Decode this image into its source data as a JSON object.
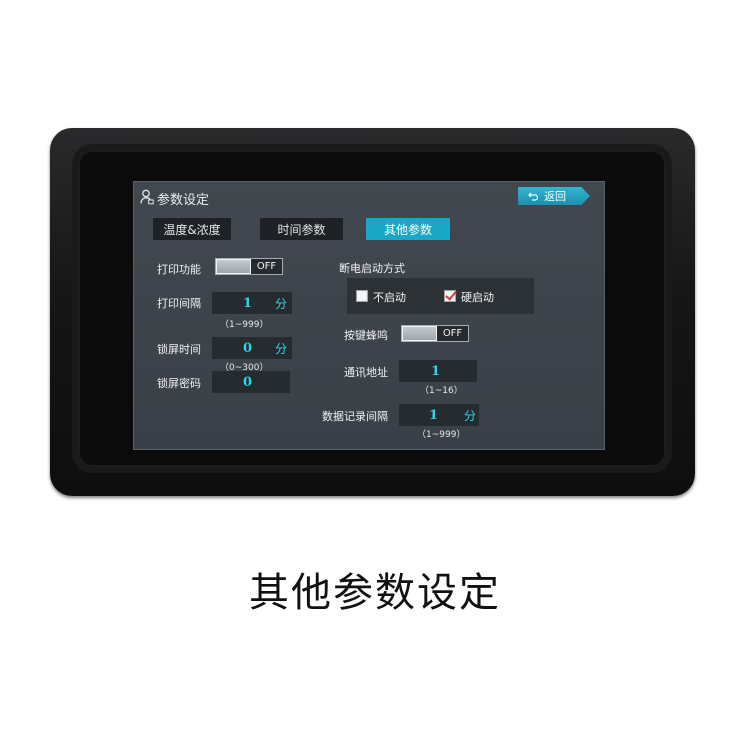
{
  "header": {
    "title": "参数设定",
    "back_label": "返回",
    "back_icon": "return-arrow-icon"
  },
  "tabs": [
    {
      "label": "温度&浓度",
      "active": false
    },
    {
      "label": "时间参数",
      "active": false
    },
    {
      "label": "其他参数",
      "active": true
    }
  ],
  "print_function": {
    "label": "打印功能",
    "state": "OFF"
  },
  "print_interval": {
    "label": "打印间隔",
    "value": "1",
    "unit": "分",
    "range": "（1~999）"
  },
  "lock_time": {
    "label": "锁屏时间",
    "value": "0",
    "unit": "分",
    "range": "（0~300）"
  },
  "lock_password": {
    "label": "锁屏密码",
    "value": "0"
  },
  "power_off_start": {
    "label": "断电启动方式",
    "options": [
      {
        "label": "不启动",
        "checked": false
      },
      {
        "label": "硬启动",
        "checked": true
      }
    ]
  },
  "key_beep": {
    "label": "按键蜂鸣",
    "state": "OFF"
  },
  "comm_address": {
    "label": "通讯地址",
    "value": "1",
    "range": "（1~16）"
  },
  "log_interval": {
    "label": "数据记录间隔",
    "value": "1",
    "unit": "分",
    "range": "（1~999）"
  },
  "caption": "其他参数设定",
  "colors": {
    "accent": "#1aa7c7",
    "value_text": "#2fd6e8",
    "screen_bg": "#3d434a"
  }
}
